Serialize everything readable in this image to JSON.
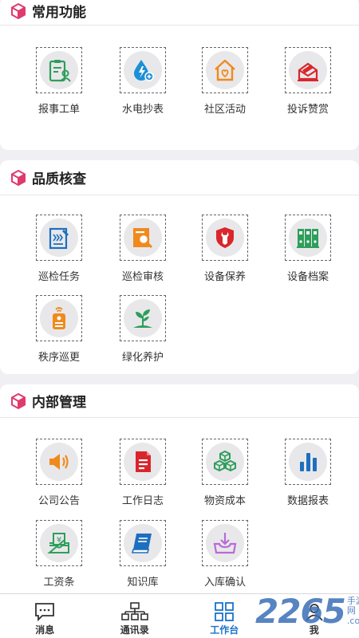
{
  "sections": [
    {
      "title": "常用功能",
      "items": [
        {
          "label": "报事工单",
          "icon": "clipboard-person-icon",
          "color": "#2e9e5b"
        },
        {
          "label": "水电抄表",
          "icon": "water-drop-electric-icon",
          "color": "#1d8fd6"
        },
        {
          "label": "社区活动",
          "icon": "house-heart-icon",
          "color": "#f08a1c"
        },
        {
          "label": "投诉赞赏",
          "icon": "envelope-icon",
          "color": "#d9262c"
        }
      ]
    },
    {
      "title": "品质核查",
      "items": [
        {
          "label": "巡检任务",
          "icon": "patrol-task-icon",
          "color": "#1d6fbf"
        },
        {
          "label": "巡检审核",
          "icon": "search-document-icon",
          "color": "#f08a1c"
        },
        {
          "label": "设备保养",
          "icon": "wrench-shield-icon",
          "color": "#d9262c"
        },
        {
          "label": "设备档案",
          "icon": "binders-icon",
          "color": "#2e9e5b"
        },
        {
          "label": "秩序巡更",
          "icon": "patrol-device-icon",
          "color": "#f08a1c"
        },
        {
          "label": "绿化养护",
          "icon": "plant-sprout-icon",
          "color": "#2e9e5b"
        }
      ]
    },
    {
      "title": "内部管理",
      "items": [
        {
          "label": "公司公告",
          "icon": "speaker-icon",
          "color": "#f08a1c"
        },
        {
          "label": "工作日志",
          "icon": "document-icon",
          "color": "#d9262c"
        },
        {
          "label": "物资成本",
          "icon": "cubes-icon",
          "color": "#2e9e5b"
        },
        {
          "label": "数据报表",
          "icon": "bar-chart-icon",
          "color": "#1d6fbf"
        },
        {
          "label": "工资条",
          "icon": "salary-tray-icon",
          "color": "#2e9e5b"
        },
        {
          "label": "知识库",
          "icon": "book-icon",
          "color": "#1d6fbf"
        },
        {
          "label": "入库确认",
          "icon": "inbox-download-icon",
          "color": "#b86ad9"
        }
      ]
    }
  ],
  "tabbar": [
    {
      "label": "消息",
      "icon": "chat-icon",
      "active": false
    },
    {
      "label": "通讯录",
      "icon": "org-chart-icon",
      "active": false
    },
    {
      "label": "工作台",
      "icon": "grid-icon",
      "active": true
    },
    {
      "label": "我",
      "icon": "person-icon",
      "active": false
    }
  ],
  "watermark": {
    "main": "2265",
    "side1": "手游网",
    "side2": ".com"
  },
  "colors": {
    "accent": "#e03a6c",
    "active_tab": "#1a73c9"
  }
}
